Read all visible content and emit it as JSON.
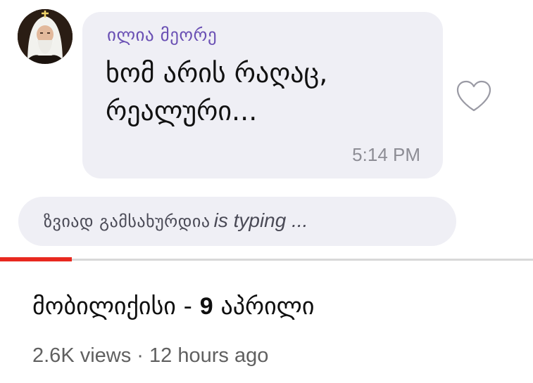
{
  "chat": {
    "sender_name": "ილია მეორე",
    "message_line1": "ხომ არის რაღაც,",
    "message_line2": "რეალური...",
    "timestamp": "5:14 PM",
    "typing_name": "ზვიად გამსახურდია",
    "typing_suffix": "is typing ..."
  },
  "video": {
    "title_part1": "მობილიქისი - ",
    "title_number": "9",
    "title_part2": " აპრილი",
    "views": "2.6K views",
    "separator": "·",
    "time_ago": "12 hours ago",
    "progress_fraction": 0.135
  },
  "icons": {
    "heart": "heart-outline-icon"
  },
  "colors": {
    "sender_name": "#6a50b4",
    "bubble_bg": "#efeff5",
    "progress_red": "#e8281f"
  }
}
